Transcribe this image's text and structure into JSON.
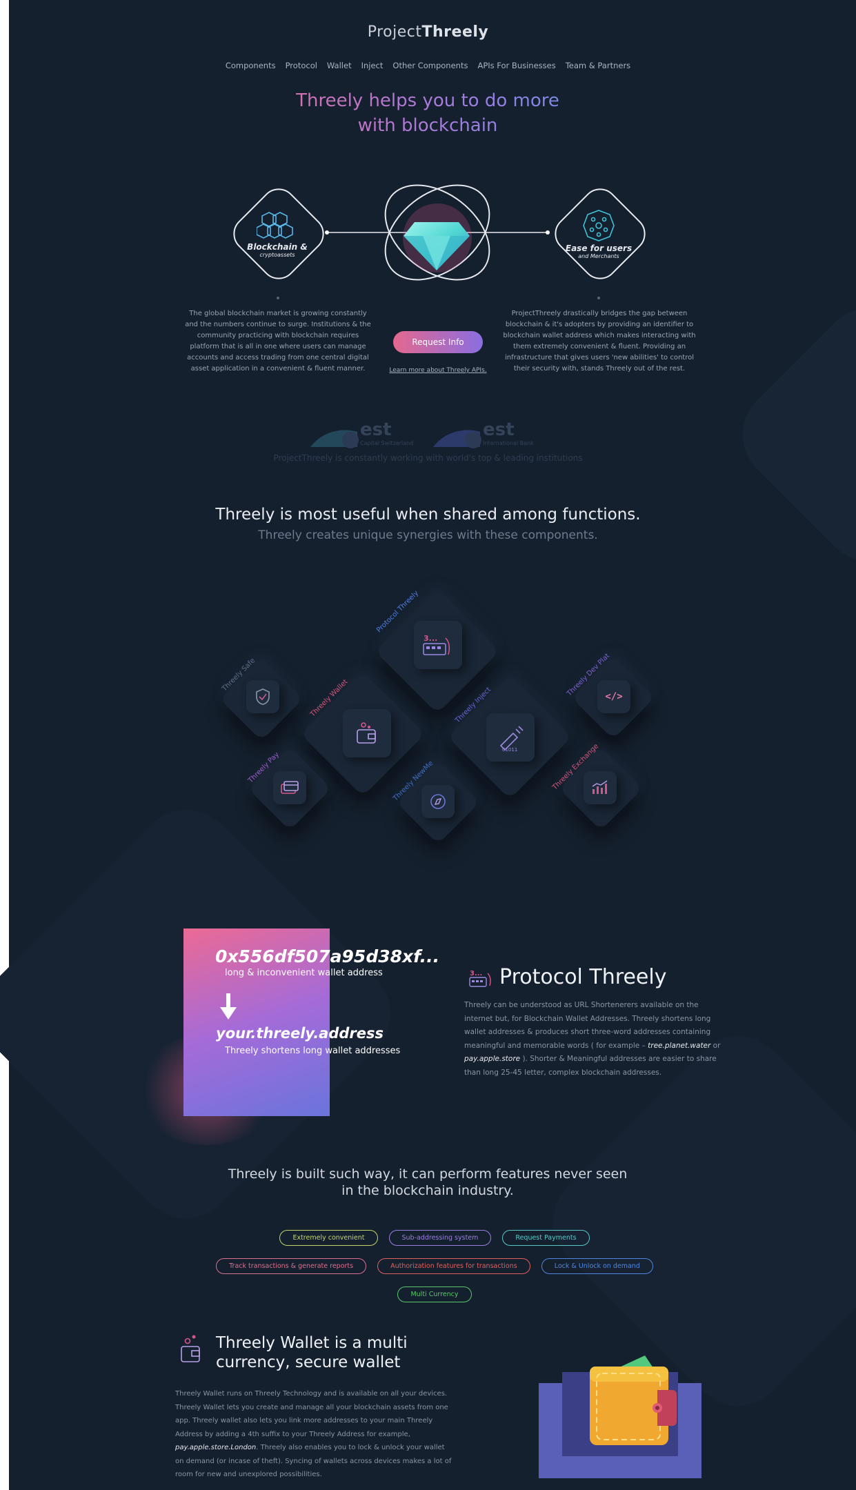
{
  "brand": {
    "prefix": "Project",
    "name": "Threely"
  },
  "nav": [
    "Components",
    "Protocol",
    "Wallet",
    "Inject",
    "Other Components",
    "APIs For Businesses",
    "Team & Partners"
  ],
  "hero": {
    "title_line1": "Threely helps you to do more",
    "title_line2": "with blockchain",
    "left_card": {
      "title": "Blockchain &",
      "subtitle": "cryptoassets"
    },
    "right_card": {
      "title": "Ease for users",
      "subtitle": "and Merchants"
    },
    "left_text": "The global blockchain market is growing constantly and the numbers continue to surge. Institutions & the community practicing with blockchain requires platform that is all in one where users can manage accounts and access trading from one central digital asset application in a convenient & fluent manner.",
    "right_text": "ProjectThreely drastically bridges the gap between blockchain & it's adopters by providing an identifier to blockchain wallet address which makes interacting with them extremely convenient & fluent. Providing an infrastructure that gives users 'new abilities' to control their security with, stands Threely out of the rest.",
    "button": "Request Info",
    "link": "Learn more about Threely APIs."
  },
  "partners": {
    "items": [
      {
        "name": "est",
        "sub": "Capital Switzerland"
      },
      {
        "name": "est",
        "sub": "International Bank"
      }
    ],
    "text": "ProjectThreely is constantly working with world's top & leading institutions"
  },
  "components": {
    "title": "Threely is most useful when shared among functions.",
    "subtitle": "Threely creates unique synergies with these components.",
    "items": [
      {
        "label": "Protocol Threely",
        "icon": "protocol-icon",
        "color": "#4f7fe6"
      },
      {
        "label": "Threely Safe",
        "icon": "shield-check-icon",
        "color": "#5f6f88"
      },
      {
        "label": "Threely Wallet",
        "icon": "wallet-icon",
        "color": "#d2567d"
      },
      {
        "label": "Threely Inject",
        "icon": "syringe-icon",
        "color": "#6a63d6"
      },
      {
        "label": "Threely Dev Plat",
        "icon": "code-icon",
        "color": "#7a62cf"
      },
      {
        "label": "Threely Pay",
        "icon": "credit-card-icon",
        "color": "#9d5fc9"
      },
      {
        "label": "Threely NewMe",
        "icon": "compass-icon",
        "color": "#3f6fc0"
      },
      {
        "label": "Threely Exchange",
        "icon": "chart-icon",
        "color": "#d2567d"
      }
    ],
    "inject_code": "01011",
    "protocol_code": "3..."
  },
  "protocol": {
    "long_address": "0x556df507a95d38xf...",
    "long_caption": "long & inconvenient wallet address",
    "short_address": "your.threely.address",
    "short_caption": "Threely shortens long wallet addresses",
    "title": "Protocol Threely",
    "text_a": "Threely can be understood as URL Shortenerers available on the internet but, for Blockchain Wallet Addresses. Threely shortens long wallet addresses & produces short three-word addresses containing meaningful and memorable words ( for example – ",
    "example1": "tree.planet.water",
    "text_b": " or ",
    "example2": "pay.apple.store",
    "text_c": " ). Shorter & Meaningful addresses are easier to share than long 25-45 letter, complex blockchain addresses."
  },
  "features": {
    "title": "Threely is built such way, it can perform features never seen in the blockchain industry.",
    "pills": [
      {
        "label": "Extremely convenient",
        "color": "#c4d46a"
      },
      {
        "label": "Sub-addressing system",
        "color": "#9b7fe0"
      },
      {
        "label": "Request Payments",
        "color": "#57c9c9"
      },
      {
        "label": "Track transactions & generate reports",
        "color": "#d9718e"
      },
      {
        "label": "Authorization features for transactions",
        "color": "#e0605e"
      },
      {
        "label": "Lock & Unlock on demand",
        "color": "#4f86e0"
      },
      {
        "label": "Multi Currency",
        "color": "#58c86a"
      }
    ]
  },
  "wallet": {
    "title_line1": "Threely Wallet is a multi",
    "title_line2": "currency, secure wallet",
    "text_a": "Threely Wallet runs on Threely Technology and is available on all your devices. Threely Wallet lets you create and manage all your blockchain assets from one app. Threely wallet also lets you link more addresses to your main Threely Address by adding a 4th suffix to your Threely Address for example, ",
    "example": "pay.apple.store.London",
    "text_b": ". Threely also enables you to lock & unlock your wallet on demand (or incase of theft). Syncing of wallets across devices makes a lot of room for new and unexplored possibilities."
  }
}
